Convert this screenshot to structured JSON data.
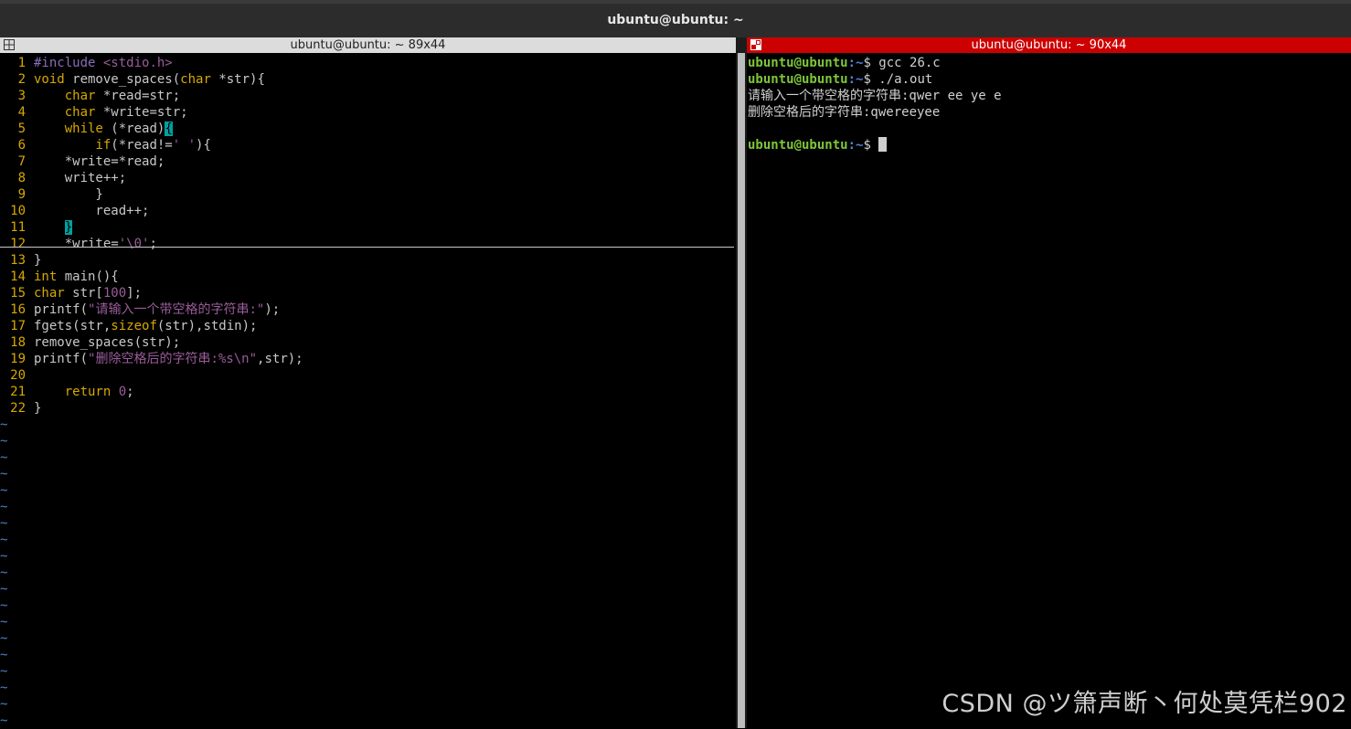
{
  "window": {
    "title": "ubuntu@ubuntu: ~"
  },
  "left_pane": {
    "title": "ubuntu@ubuntu: ~ 89x44",
    "code_lines": [
      {
        "n": "1",
        "text": "#include <stdio.h>"
      },
      {
        "n": "2",
        "text": "void remove_spaces(char *str){"
      },
      {
        "n": "3",
        "text": "    char *read=str;"
      },
      {
        "n": "4",
        "text": "    char *write=str;"
      },
      {
        "n": "5",
        "text": "    while (*read){"
      },
      {
        "n": "6",
        "text": "        if(*read!=' '){"
      },
      {
        "n": "7",
        "text": "    *write=*read;"
      },
      {
        "n": "8",
        "text": "    write++;"
      },
      {
        "n": "9",
        "text": "        }"
      },
      {
        "n": "10",
        "text": "        read++;"
      },
      {
        "n": "11",
        "text": "    }"
      },
      {
        "n": "12",
        "text": "    *write='\\0';"
      },
      {
        "n": "13",
        "text": "}"
      },
      {
        "n": "14",
        "text": "int main(){"
      },
      {
        "n": "15",
        "text": "char str[100];"
      },
      {
        "n": "16",
        "text": "printf(\"请输入一个带空格的字符串:\");"
      },
      {
        "n": "17",
        "text": "fgets(str,sizeof(str),stdin);"
      },
      {
        "n": "18",
        "text": "remove_spaces(str);"
      },
      {
        "n": "19",
        "text": "printf(\"删除空格后的字符串:%s\\n\",str);"
      },
      {
        "n": "20",
        "text": ""
      },
      {
        "n": "21",
        "text": "    return 0;"
      },
      {
        "n": "22",
        "text": "}"
      }
    ],
    "tilde": "~"
  },
  "right_pane": {
    "title": "ubuntu@ubuntu: ~ 90x44",
    "prompt_user": "ubuntu@ubuntu",
    "prompt_path": ":~",
    "prompt_symbol": "$",
    "lines": [
      {
        "type": "cmd",
        "text": " gcc 26.c"
      },
      {
        "type": "cmd",
        "text": " ./a.out"
      },
      {
        "type": "out",
        "text": "请输入一个带空格的字符串:qwer ee ye e"
      },
      {
        "type": "out",
        "text": "删除空格后的字符串:qwereeyee"
      },
      {
        "type": "out",
        "text": ""
      },
      {
        "type": "cmd",
        "text": " "
      }
    ]
  },
  "watermark": "CSDN @ツ箫声断丶何处莫凭栏902",
  "colors": {
    "active_title": "#cc0000",
    "line_numbers": "#d7a800",
    "prompt_user": "#7ec63a",
    "prompt_path": "#4f83d6"
  }
}
